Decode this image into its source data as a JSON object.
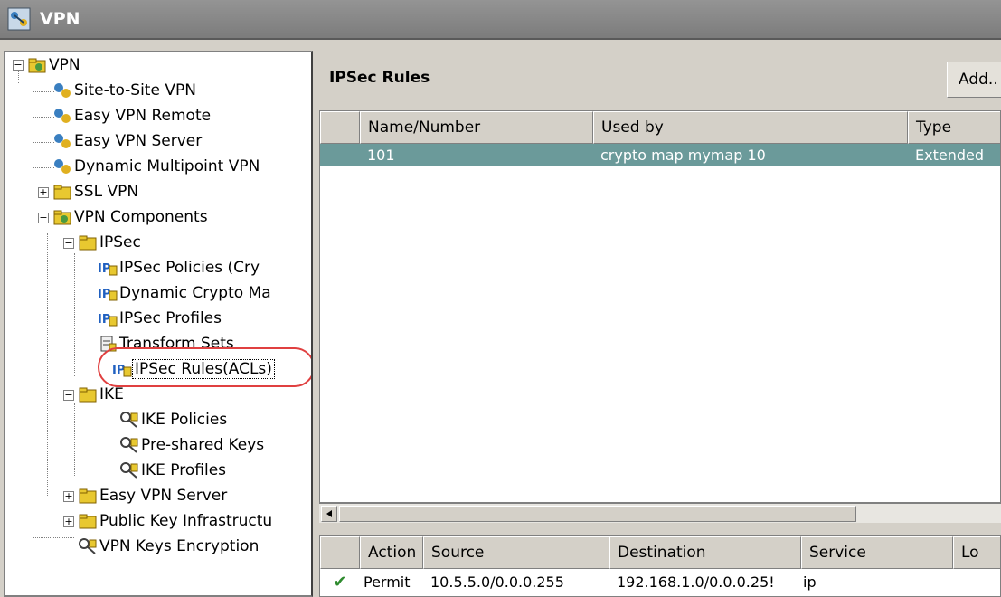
{
  "window": {
    "title": "VPN"
  },
  "tree": {
    "items": [
      {
        "label": "VPN"
      },
      {
        "label": "Site-to-Site VPN"
      },
      {
        "label": "Easy VPN Remote"
      },
      {
        "label": "Easy VPN Server"
      },
      {
        "label": "Dynamic Multipoint VPN"
      },
      {
        "label": "SSL VPN"
      },
      {
        "label": "VPN Components"
      },
      {
        "label": "IPSec"
      },
      {
        "label": "IPSec Policies (Cry"
      },
      {
        "label": "Dynamic Crypto Ma"
      },
      {
        "label": "IPSec Profiles"
      },
      {
        "label": "Transform Sets"
      },
      {
        "label": "IPSec Rules(ACLs)"
      },
      {
        "label": "IKE"
      },
      {
        "label": "IKE Policies"
      },
      {
        "label": "Pre-shared Keys"
      },
      {
        "label": "IKE Profiles"
      },
      {
        "label": "Easy VPN Server"
      },
      {
        "label": "Public Key Infrastructu"
      },
      {
        "label": "VPN Keys Encryption"
      }
    ],
    "selected": "IPSec Rules(ACLs)"
  },
  "rules_panel": {
    "title": "IPSec Rules",
    "add_label": "Add.."
  },
  "rules_table": {
    "columns": [
      "Name/Number",
      "Used by",
      "Type"
    ],
    "rows": [
      {
        "name": "101",
        "used_by": "crypto map mymap 10",
        "type": "Extended"
      }
    ]
  },
  "entries_table": {
    "columns": [
      "Action",
      "Source",
      "Destination",
      "Service",
      "Lo"
    ],
    "rows": [
      {
        "action": "Permit",
        "source": "10.5.5.0/0.0.0.255",
        "destination": "192.168.1.0/0.0.0.25!",
        "service": "ip"
      }
    ]
  },
  "colors": {
    "title_bar": "#8a8a8a",
    "selected_row": "#6b9a9a",
    "highlight_ring": "#e04040"
  }
}
